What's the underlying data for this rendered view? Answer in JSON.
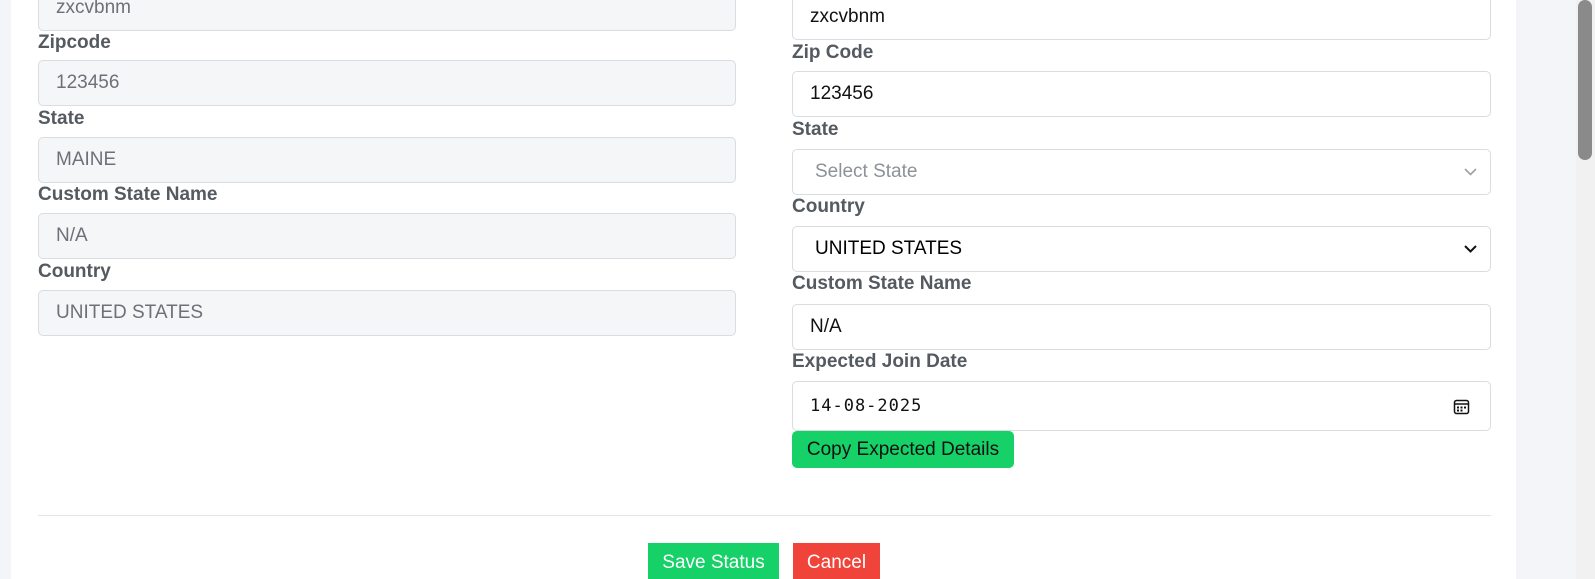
{
  "left": {
    "address_value": "zxcvbnm",
    "zipcode_label": "Zipcode",
    "zipcode_value": "123456",
    "state_label": "State",
    "state_value": "MAINE",
    "custom_state_label": "Custom State Name",
    "custom_state_value": "N/A",
    "country_label": "Country",
    "country_value": "UNITED STATES"
  },
  "right": {
    "address_value": "zxcvbnm",
    "zipcode_label": "Zip Code",
    "zipcode_value": "123456",
    "state_label": "State",
    "state_placeholder": "Select State",
    "country_label": "Country",
    "country_value": "UNITED STATES",
    "custom_state_label": "Custom State Name",
    "custom_state_value": "N/A",
    "join_date_label": "Expected Join Date",
    "join_date_value": "14-08-2025",
    "copy_button": "Copy Expected Details"
  },
  "footer": {
    "save_button": "Save Status",
    "cancel_button": "Cancel"
  },
  "colors": {
    "primary_green": "#15d167",
    "danger_red": "#f0433a"
  },
  "icons": {
    "select_chevron": "chevron-down-icon",
    "calendar": "calendar-icon"
  }
}
